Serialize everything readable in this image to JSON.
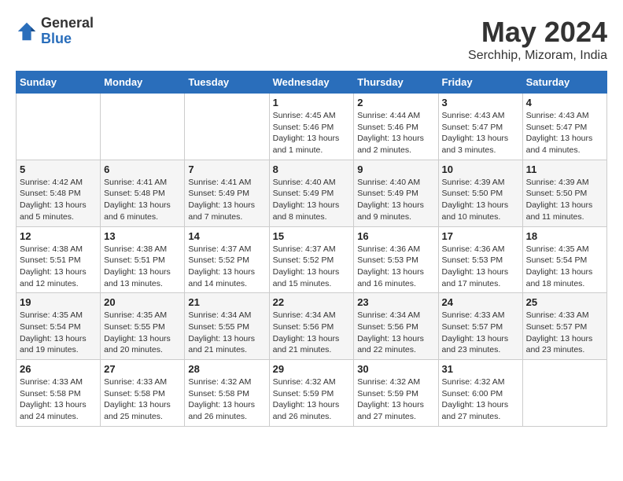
{
  "header": {
    "logo_general": "General",
    "logo_blue": "Blue",
    "month_year": "May 2024",
    "location": "Serchhip, Mizoram, India"
  },
  "weekdays": [
    "Sunday",
    "Monday",
    "Tuesday",
    "Wednesday",
    "Thursday",
    "Friday",
    "Saturday"
  ],
  "weeks": [
    [
      {
        "day": "",
        "info": ""
      },
      {
        "day": "",
        "info": ""
      },
      {
        "day": "",
        "info": ""
      },
      {
        "day": "1",
        "info": "Sunrise: 4:45 AM\nSunset: 5:46 PM\nDaylight: 13 hours\nand 1 minute."
      },
      {
        "day": "2",
        "info": "Sunrise: 4:44 AM\nSunset: 5:46 PM\nDaylight: 13 hours\nand 2 minutes."
      },
      {
        "day": "3",
        "info": "Sunrise: 4:43 AM\nSunset: 5:47 PM\nDaylight: 13 hours\nand 3 minutes."
      },
      {
        "day": "4",
        "info": "Sunrise: 4:43 AM\nSunset: 5:47 PM\nDaylight: 13 hours\nand 4 minutes."
      }
    ],
    [
      {
        "day": "5",
        "info": "Sunrise: 4:42 AM\nSunset: 5:48 PM\nDaylight: 13 hours\nand 5 minutes."
      },
      {
        "day": "6",
        "info": "Sunrise: 4:41 AM\nSunset: 5:48 PM\nDaylight: 13 hours\nand 6 minutes."
      },
      {
        "day": "7",
        "info": "Sunrise: 4:41 AM\nSunset: 5:49 PM\nDaylight: 13 hours\nand 7 minutes."
      },
      {
        "day": "8",
        "info": "Sunrise: 4:40 AM\nSunset: 5:49 PM\nDaylight: 13 hours\nand 8 minutes."
      },
      {
        "day": "9",
        "info": "Sunrise: 4:40 AM\nSunset: 5:49 PM\nDaylight: 13 hours\nand 9 minutes."
      },
      {
        "day": "10",
        "info": "Sunrise: 4:39 AM\nSunset: 5:50 PM\nDaylight: 13 hours\nand 10 minutes."
      },
      {
        "day": "11",
        "info": "Sunrise: 4:39 AM\nSunset: 5:50 PM\nDaylight: 13 hours\nand 11 minutes."
      }
    ],
    [
      {
        "day": "12",
        "info": "Sunrise: 4:38 AM\nSunset: 5:51 PM\nDaylight: 13 hours\nand 12 minutes."
      },
      {
        "day": "13",
        "info": "Sunrise: 4:38 AM\nSunset: 5:51 PM\nDaylight: 13 hours\nand 13 minutes."
      },
      {
        "day": "14",
        "info": "Sunrise: 4:37 AM\nSunset: 5:52 PM\nDaylight: 13 hours\nand 14 minutes."
      },
      {
        "day": "15",
        "info": "Sunrise: 4:37 AM\nSunset: 5:52 PM\nDaylight: 13 hours\nand 15 minutes."
      },
      {
        "day": "16",
        "info": "Sunrise: 4:36 AM\nSunset: 5:53 PM\nDaylight: 13 hours\nand 16 minutes."
      },
      {
        "day": "17",
        "info": "Sunrise: 4:36 AM\nSunset: 5:53 PM\nDaylight: 13 hours\nand 17 minutes."
      },
      {
        "day": "18",
        "info": "Sunrise: 4:35 AM\nSunset: 5:54 PM\nDaylight: 13 hours\nand 18 minutes."
      }
    ],
    [
      {
        "day": "19",
        "info": "Sunrise: 4:35 AM\nSunset: 5:54 PM\nDaylight: 13 hours\nand 19 minutes."
      },
      {
        "day": "20",
        "info": "Sunrise: 4:35 AM\nSunset: 5:55 PM\nDaylight: 13 hours\nand 20 minutes."
      },
      {
        "day": "21",
        "info": "Sunrise: 4:34 AM\nSunset: 5:55 PM\nDaylight: 13 hours\nand 21 minutes."
      },
      {
        "day": "22",
        "info": "Sunrise: 4:34 AM\nSunset: 5:56 PM\nDaylight: 13 hours\nand 21 minutes."
      },
      {
        "day": "23",
        "info": "Sunrise: 4:34 AM\nSunset: 5:56 PM\nDaylight: 13 hours\nand 22 minutes."
      },
      {
        "day": "24",
        "info": "Sunrise: 4:33 AM\nSunset: 5:57 PM\nDaylight: 13 hours\nand 23 minutes."
      },
      {
        "day": "25",
        "info": "Sunrise: 4:33 AM\nSunset: 5:57 PM\nDaylight: 13 hours\nand 23 minutes."
      }
    ],
    [
      {
        "day": "26",
        "info": "Sunrise: 4:33 AM\nSunset: 5:58 PM\nDaylight: 13 hours\nand 24 minutes."
      },
      {
        "day": "27",
        "info": "Sunrise: 4:33 AM\nSunset: 5:58 PM\nDaylight: 13 hours\nand 25 minutes."
      },
      {
        "day": "28",
        "info": "Sunrise: 4:32 AM\nSunset: 5:58 PM\nDaylight: 13 hours\nand 26 minutes."
      },
      {
        "day": "29",
        "info": "Sunrise: 4:32 AM\nSunset: 5:59 PM\nDaylight: 13 hours\nand 26 minutes."
      },
      {
        "day": "30",
        "info": "Sunrise: 4:32 AM\nSunset: 5:59 PM\nDaylight: 13 hours\nand 27 minutes."
      },
      {
        "day": "31",
        "info": "Sunrise: 4:32 AM\nSunset: 6:00 PM\nDaylight: 13 hours\nand 27 minutes."
      },
      {
        "day": "",
        "info": ""
      }
    ]
  ]
}
